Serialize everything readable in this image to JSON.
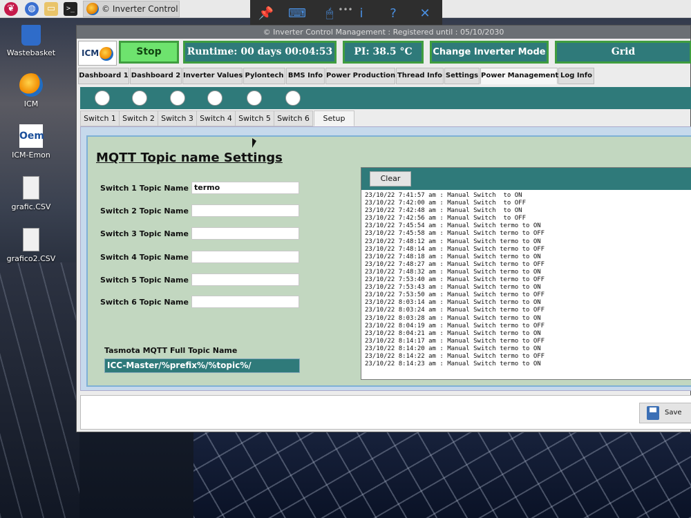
{
  "taskbar": {
    "task_title": "© Inverter Control M…",
    "icons": [
      "raspberry-icon",
      "globe-icon",
      "folder-icon",
      "terminal-icon"
    ]
  },
  "floating_toolbar": {
    "icons": [
      "pin-icon",
      "keyboard-icon",
      "mouse-icon",
      "info-icon",
      "help-icon",
      "close-icon"
    ],
    "glyphs": [
      "📌",
      "⌨",
      "🖱",
      "i",
      "?",
      "✕"
    ]
  },
  "desktop": {
    "items": [
      {
        "label": "Wastebasket",
        "icon": "wastebasket-icon"
      },
      {
        "label": "ICM",
        "icon": "icm-globe-icon"
      },
      {
        "label": "ICM-Emon",
        "icon": "oem-icon",
        "icon_text": "Oem"
      },
      {
        "label": "grafic.CSV",
        "icon": "file-icon"
      },
      {
        "label": "grafico2.CSV",
        "icon": "file-icon"
      }
    ]
  },
  "window": {
    "title": "© Inverter Control Management : Registered until : 05/10/2030"
  },
  "statusbar": {
    "logo_text": "ICM",
    "stop_label": "Stop",
    "runtime": "Runtime: 00 days 00:04:53",
    "pi_temp": "PI: 38.5 °C",
    "change_mode_label": "Change Inverter Mode",
    "grid_label": "Grid"
  },
  "main_tabs": [
    {
      "label": "Dashboard 1"
    },
    {
      "label": "Dashboard 2"
    },
    {
      "label": "Inverter Values"
    },
    {
      "label": "Pylontech"
    },
    {
      "label": "BMS Info"
    },
    {
      "label": "Power Production"
    },
    {
      "label": "Thread Info"
    },
    {
      "label": "Settings"
    },
    {
      "label": "Power Management",
      "active": true
    },
    {
      "label": "Log Info"
    }
  ],
  "switch_tabs": [
    {
      "label": "Switch 1"
    },
    {
      "label": "Switch 2"
    },
    {
      "label": "Switch 3"
    },
    {
      "label": "Switch 4"
    },
    {
      "label": "Switch 5"
    },
    {
      "label": "Switch 6"
    },
    {
      "label": "Setup",
      "active": true
    }
  ],
  "setup": {
    "title": "MQTT Topic name Settings",
    "rows": [
      {
        "label": "Switch 1 Topic Name",
        "value": "termo"
      },
      {
        "label": "Switch 2 Topic Name",
        "value": ""
      },
      {
        "label": "Switch 3 Topic Name",
        "value": ""
      },
      {
        "label": "Switch 4 Topic Name",
        "value": ""
      },
      {
        "label": "Switch 5 Topic Name",
        "value": ""
      },
      {
        "label": "Switch 6 Topic Name",
        "value": ""
      }
    ],
    "tasmota_label": "Tasmota MQTT Full Topic Name",
    "tasmota_value": "ICC-Master/%prefix%/%topic%/"
  },
  "log": {
    "clear_label": "Clear",
    "lines": [
      "23/10/22 7:41:57 am : Manual Switch  to ON",
      "23/10/22 7:42:00 am : Manual Switch  to OFF",
      "23/10/22 7:42:48 am : Manual Switch  to ON",
      "23/10/22 7:42:56 am : Manual Switch  to OFF",
      "23/10/22 7:45:54 am : Manual Switch termo to ON",
      "23/10/22 7:45:58 am : Manual Switch termo to OFF",
      "23/10/22 7:48:12 am : Manual Switch termo to ON",
      "23/10/22 7:48:14 am : Manual Switch termo to OFF",
      "23/10/22 7:48:18 am : Manual Switch termo to ON",
      "23/10/22 7:48:27 am : Manual Switch termo to OFF",
      "23/10/22 7:48:32 am : Manual Switch termo to ON",
      "23/10/22 7:53:40 am : Manual Switch termo to OFF",
      "23/10/22 7:53:43 am : Manual Switch termo to ON",
      "23/10/22 7:53:50 am : Manual Switch termo to OFF",
      "23/10/22 8:03:14 am : Manual Switch termo to ON",
      "23/10/22 8:03:24 am : Manual Switch termo to OFF",
      "23/10/22 8:03:28 am : Manual Switch termo to ON",
      "23/10/22 8:04:19 am : Manual Switch termo to OFF",
      "23/10/22 8:04:21 am : Manual Switch termo to ON",
      "23/10/22 8:14:17 am : Manual Switch termo to OFF",
      "23/10/22 8:14:20 am : Manual Switch termo to ON",
      "23/10/22 8:14:22 am : Manual Switch termo to OFF",
      "23/10/22 8:14:23 am : Manual Switch termo to ON"
    ]
  },
  "footer": {
    "save_label": "Save"
  },
  "colors": {
    "teal": "#2f7a7a",
    "status_border": "#3f9d3f",
    "stop_green": "#6ee36e",
    "panel_green": "#c2d7c0"
  }
}
